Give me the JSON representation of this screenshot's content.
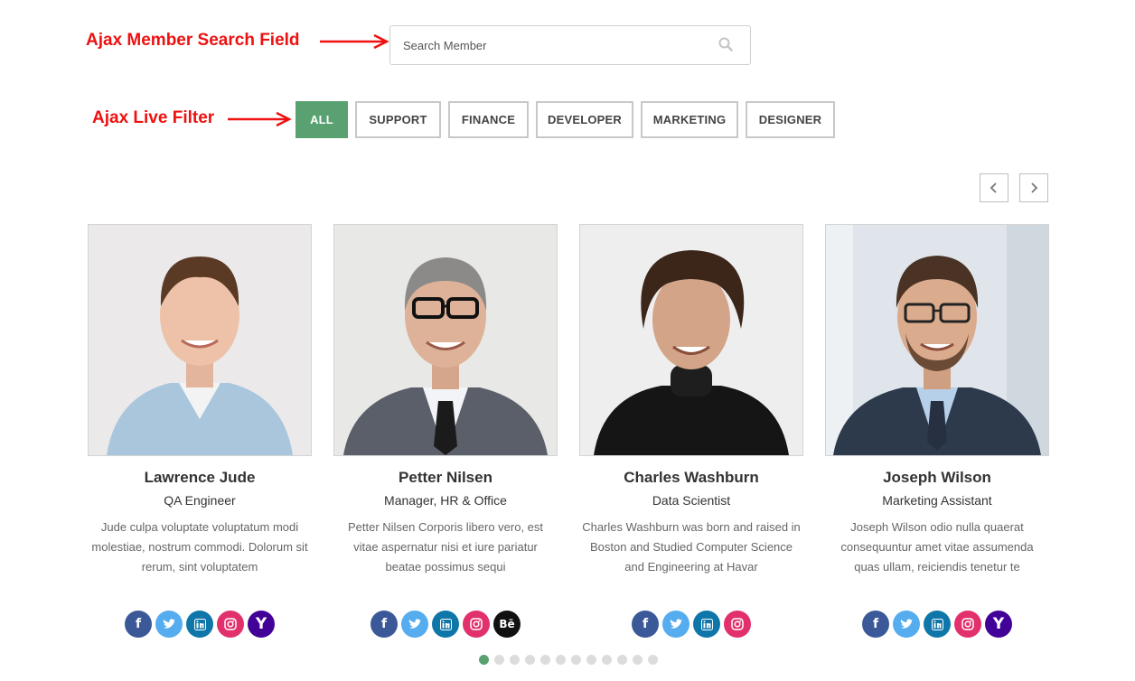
{
  "annotations": {
    "search_label": "Ajax Member Search Field",
    "filter_label": "Ajax Live Filter"
  },
  "search": {
    "placeholder": "Search Member",
    "value": ""
  },
  "filters": [
    {
      "label": "ALL",
      "active": true
    },
    {
      "label": "SUPPORT",
      "active": false
    },
    {
      "label": "FINANCE",
      "active": false
    },
    {
      "label": "DEVELOPER",
      "active": false
    },
    {
      "label": "MARKETING",
      "active": false
    },
    {
      "label": "DESIGNER",
      "active": false
    }
  ],
  "carousel": {
    "prev_icon": "chevron-left-icon",
    "next_icon": "chevron-right-icon",
    "dot_count": 12,
    "active_dot": 1
  },
  "members": [
    {
      "name": "Lawrence Jude",
      "role": "QA Engineer",
      "bio": "Jude culpa voluptate voluptatum modi molestiae, nostrum commodi. Dolorum sit rerum, sint voluptatem",
      "socials": [
        "facebook",
        "twitter",
        "linkedin",
        "instagram",
        "yahoo"
      ]
    },
    {
      "name": "Petter Nilsen",
      "role": "Manager, HR & Office",
      "bio": "Petter Nilsen Corporis libero vero, est vitae aspernatur nisi et iure pariatur beatae possimus sequi",
      "socials": [
        "facebook",
        "twitter",
        "linkedin",
        "instagram",
        "behance"
      ]
    },
    {
      "name": "Charles Washburn",
      "role": "Data Scientist",
      "bio": "Charles Washburn was born and raised in Boston and Studied Computer Science and Engineering at Havar",
      "socials": [
        "facebook",
        "twitter",
        "linkedin",
        "instagram"
      ]
    },
    {
      "name": "Joseph Wilson",
      "role": "Marketing Assistant",
      "bio": "Joseph Wilson odio nulla quaerat consequuntur amet vitae assumenda quas ullam, reiciendis tenetur te",
      "socials": [
        "facebook",
        "twitter",
        "linkedin",
        "instagram",
        "yahoo"
      ]
    }
  ],
  "social_styles": {
    "facebook": {
      "color": "#3b5998",
      "glyph": "f"
    },
    "twitter": {
      "color": "#55acee",
      "glyph": "t"
    },
    "linkedin": {
      "color": "#0e76a8",
      "glyph": "in"
    },
    "instagram": {
      "color": "#e1306c",
      "glyph": "ig"
    },
    "yahoo": {
      "color": "#430297",
      "glyph": "Y"
    },
    "behance": {
      "color": "#111111",
      "glyph": "Bē"
    }
  },
  "colors": {
    "accent": "#5aa171",
    "annotation": "#ee1111"
  }
}
